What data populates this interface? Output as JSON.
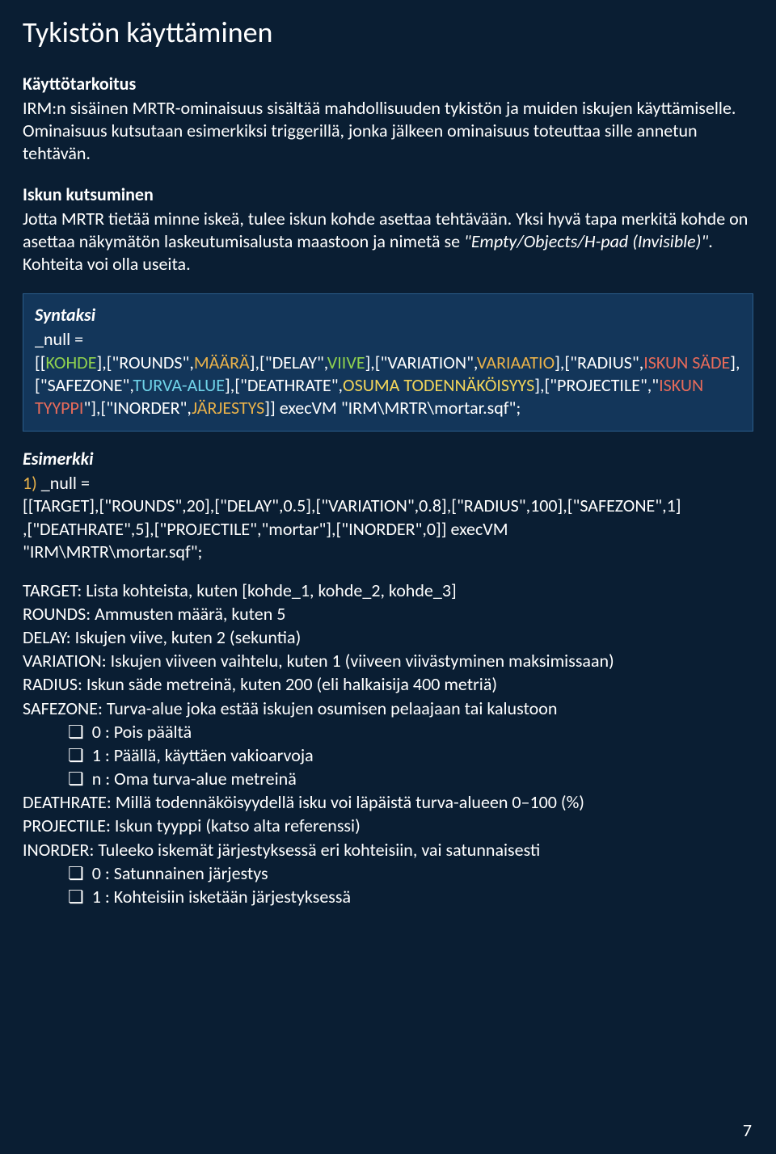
{
  "title": "Tykistön käyttäminen",
  "intro": {
    "heading": "Käyttötarkoitus",
    "text": "IRM:n sisäinen MRTR-ominaisuus sisältää mahdollisuuden tykistön ja muiden iskujen käyttämiselle. Ominaisuus kutsutaan esimerkiksi triggerillä, jonka jälkeen ominaisuus toteuttaa sille annetun tehtävän."
  },
  "call": {
    "heading": "Iskun kutsuminen",
    "text_pre": "Jotta MRTR tietää minne iskeä, tulee iskun kohde asettaa tehtävään. Yksi hyvä tapa merkitä kohde on asettaa näkymätön laskeutumisalusta maastoon ja nimetä se ",
    "text_em": "\"Empty/Objects/H-pad (Invisible)\"",
    "text_post": ". Kohteita voi olla useita."
  },
  "syntax": {
    "heading": "Syntaksi",
    "null_line": "_null =",
    "seg1": "[[",
    "kohde": "KOHDE",
    "seg2": "],[\"ROUNDS\",",
    "maara": "MÄÄRÄ",
    "seg3": "],[\"DELAY\",",
    "viive": "VIIVE",
    "seg4": "],[\"VARIATION\",",
    "variaatio": "VARIAATIO",
    "seg5": "],[\"RADIUS\",",
    "saede_l1": "ISKUN ",
    "saede_l2": "SÄDE",
    "seg6": "],[\"SAFEZONE\",",
    "turva": "TURVA-ALUE",
    "seg7": "],[\"DEATHRATE\",",
    "osuma_l1": "OSUMA ",
    "osuma_l2": "TODENNÄKÖISYYS",
    "seg8": "],[\"PROJECTILE\",\"",
    "tyyppi": "ISKUN TYYPPI",
    "seg9": "\"],[\"INORDER\",",
    "jarj": "JÄRJESTYS",
    "seg10": "]] execVM \"IRM\\MRTR\\mortar.sqf\";"
  },
  "example": {
    "heading": "Esimerkki",
    "num": "1)",
    "null_line": " _null =",
    "line1": "[[TARGET],[\"ROUNDS\",20],[\"DELAY\",0.5],[\"VARIATION\",0.8],[\"RADIUS\",100],[\"SAFEZONE\",1]",
    "line2": ",[\"DEATHRATE\",5],[\"PROJECTILE\",\"mortar\"],[\"INORDER\",0]] execVM",
    "line3": "\"IRM\\MRTR\\mortar.sqf\";"
  },
  "defs": {
    "target": "TARGET: Lista kohteista, kuten [kohde_1, kohde_2, kohde_3]",
    "rounds": "ROUNDS: Ammusten määrä, kuten 5",
    "delay": "DELAY: Iskujen viive, kuten 2 (sekuntia)",
    "variation": "VARIATION: Iskujen viiveen vaihtelu, kuten 1 (viiveen viivästyminen maksimissaan)",
    "radius": "RADIUS: Iskun säde metreinä, kuten 200 (eli halkaisija 400 metriä)",
    "safezone": "SAFEZONE: Turva-alue joka estää iskujen osumisen pelaajaan tai kalustoon",
    "safezone_items": [
      "0 : Pois päältä",
      "1 : Päällä, käyttäen vakioarvoja",
      "n : Oma turva-alue metreinä"
    ],
    "deathrate": "DEATHRATE: Millä todennäköisyydellä isku voi läpäistä turva-alueen 0–100 (%)",
    "projectile": "PROJECTILE: Iskun tyyppi (katso alta referenssi)",
    "inorder": "INORDER: Tuleeko iskemät järjestyksessä eri kohteisiin, vai satunnaisesti",
    "inorder_items": [
      "0 : Satunnainen järjestys",
      "1 : Kohteisiin isketään järjestyksessä"
    ]
  },
  "pagenum": "7"
}
